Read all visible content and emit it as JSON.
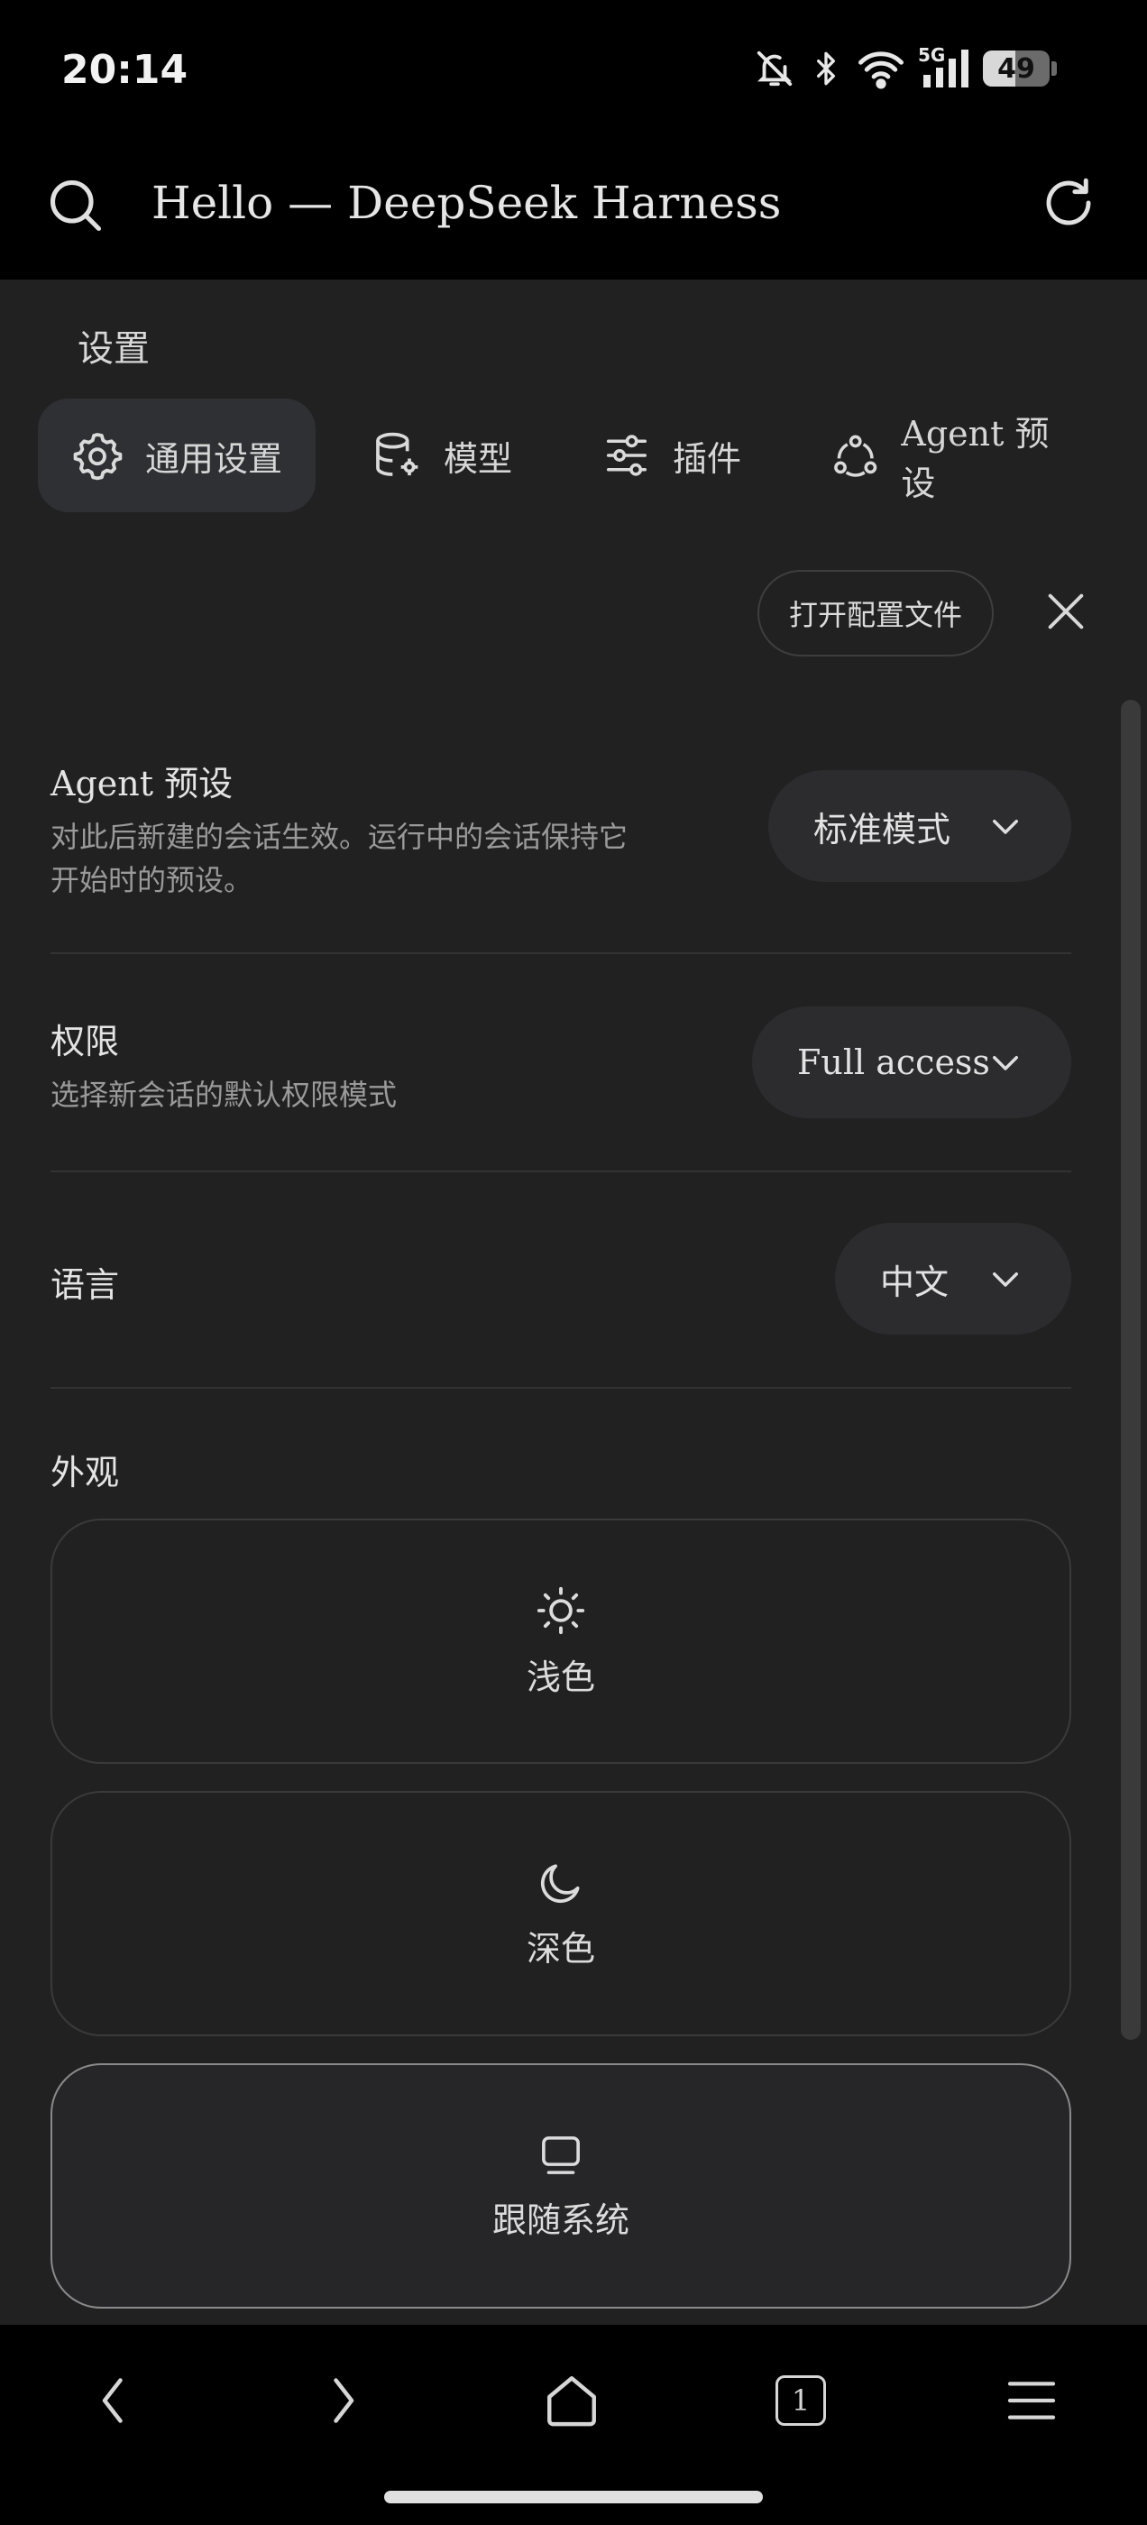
{
  "status_bar": {
    "time": "20:14",
    "network": "5G",
    "battery": "49",
    "battery_level": 0.49
  },
  "url_bar": {
    "title": "Hello — DeepSeek Harness"
  },
  "settings": {
    "heading": "设置",
    "tabs": [
      {
        "label": "通用设置",
        "icon": "gear-icon",
        "active": true
      },
      {
        "label": "模型",
        "icon": "database-gear-icon",
        "active": false
      },
      {
        "label": "插件",
        "icon": "sliders-icon",
        "active": false
      },
      {
        "label": "Agent 预设",
        "icon": "agent-nodes-icon",
        "active": false
      }
    ],
    "open_config_label": "打开配置文件",
    "agent_preset": {
      "title": "Agent 预设",
      "description": "对此后新建的会话生效。运行中的会话保持它开始时的预设。",
      "value": "标准模式"
    },
    "permissions": {
      "title": "权限",
      "description": "选择新会话的默认权限模式",
      "value": "Full access"
    },
    "language": {
      "title": "语言",
      "value": "中文"
    },
    "appearance": {
      "title": "外观",
      "options": [
        {
          "label": "浅色",
          "icon": "sun-icon",
          "selected": false
        },
        {
          "label": "深色",
          "icon": "moon-icon",
          "selected": false
        },
        {
          "label": "跟随系统",
          "icon": "monitor-icon",
          "selected": true
        }
      ]
    }
  },
  "bottom_nav": {
    "tab_count": "1"
  }
}
